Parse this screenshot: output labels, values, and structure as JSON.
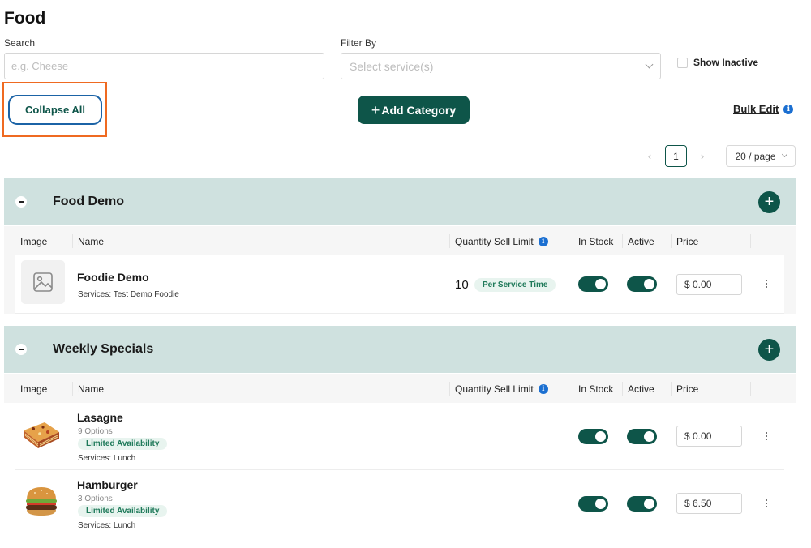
{
  "page": {
    "title": "Food"
  },
  "search": {
    "label": "Search",
    "placeholder": "e.g. Cheese"
  },
  "filter": {
    "label": "Filter By",
    "placeholder": "Select service(s)"
  },
  "show_inactive": {
    "label": "Show Inactive",
    "checked": false
  },
  "actions": {
    "collapse_all": "Collapse All",
    "add_category": "Add Category",
    "bulk_edit": "Bulk Edit"
  },
  "pagination": {
    "current_page": "1",
    "page_size": "20 / page"
  },
  "columns": {
    "image": "Image",
    "name": "Name",
    "quantity_sell_limit": "Quantity Sell Limit",
    "in_stock": "In Stock",
    "active": "Active",
    "price": "Price"
  },
  "categories": [
    {
      "name": "Food Demo",
      "items": [
        {
          "name": "Foodie Demo",
          "services": "Services: Test Demo Foodie",
          "quantity": "10",
          "quantity_unit": "Per Service Time",
          "in_stock": true,
          "active": true,
          "price": "$ 0.00",
          "image": "image-placeholder-icon"
        }
      ]
    },
    {
      "name": "Weekly Specials",
      "items": [
        {
          "name": "Lasagne",
          "options": "9 Options",
          "badge": "Limited Availability",
          "services": "Services: Lunch",
          "in_stock": true,
          "active": true,
          "price": "$ 0.00",
          "image": "lasagne"
        },
        {
          "name": "Hamburger",
          "options": "3 Options",
          "badge": "Limited Availability",
          "services": "Services: Lunch",
          "in_stock": true,
          "active": true,
          "price": "$ 6.50",
          "image": "hamburger"
        }
      ]
    }
  ],
  "colors": {
    "primary": "#0e5549",
    "category_bg": "#cfe1df",
    "highlight": "#ef6a21",
    "info": "#1b6fd1"
  }
}
